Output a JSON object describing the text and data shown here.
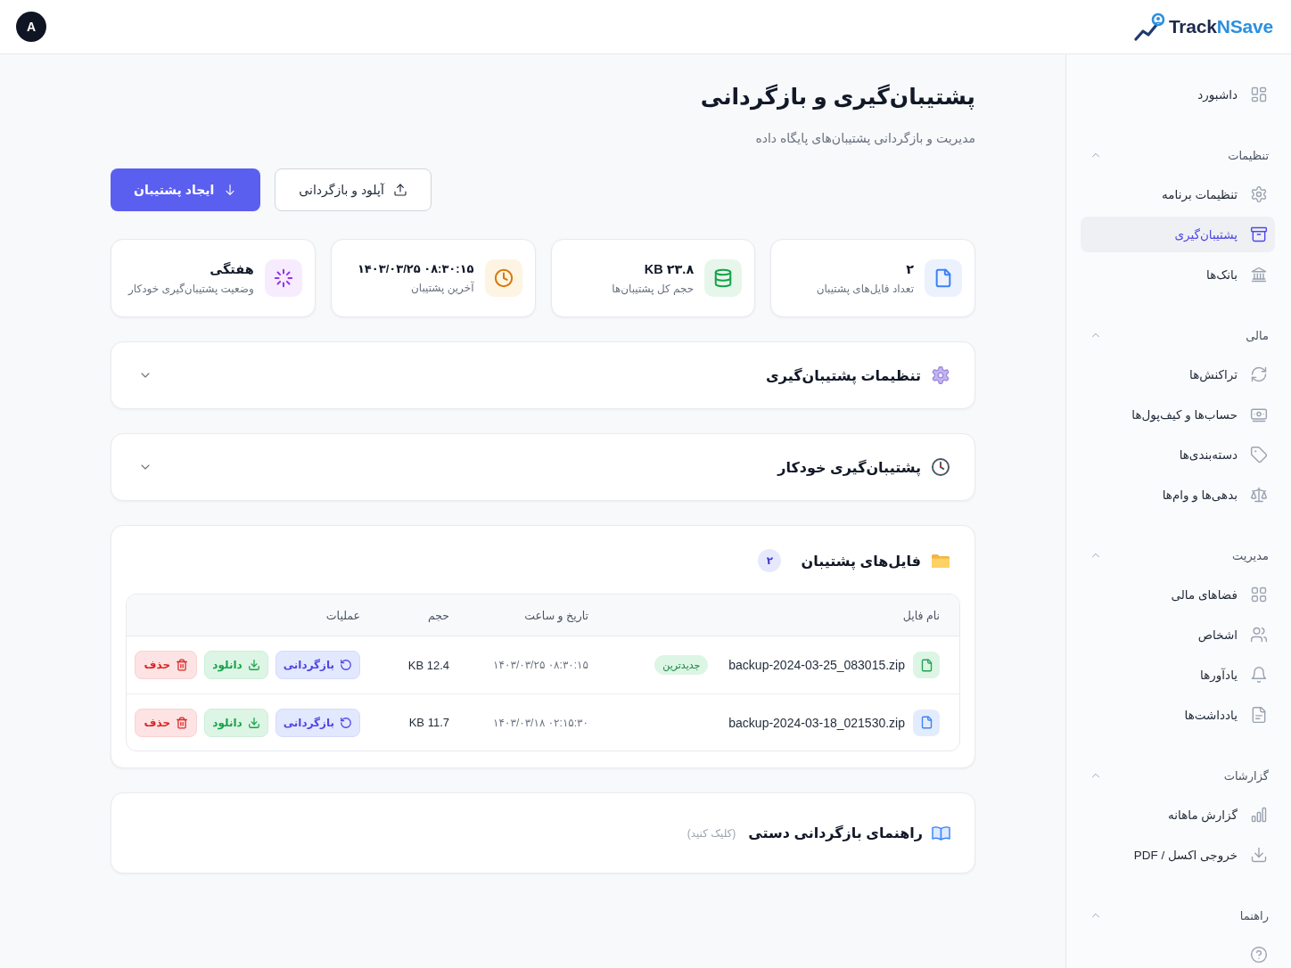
{
  "header": {
    "logo": {
      "text": "Track",
      "accent": "NSave"
    },
    "avatar": {
      "initial": "A"
    }
  },
  "sidebar": {
    "top_items": [
      {
        "label": "داشبورد",
        "selected": false
      }
    ],
    "sections": [
      {
        "title": "تنظیمات",
        "expanded": true,
        "items": [
          {
            "label": "تنظیمات برنامه",
            "selected": false
          },
          {
            "label": "پشتیبان‌گیری",
            "selected": true
          },
          {
            "label": "بانک‌ها",
            "selected": false
          }
        ]
      },
      {
        "title": "مالی",
        "expanded": true,
        "items": [
          {
            "label": "تراکنش‌ها",
            "selected": false
          },
          {
            "label": "حساب‌ها و کیف‌پول‌ها",
            "selected": false
          },
          {
            "label": "دسته‌بندی‌ها",
            "selected": false
          },
          {
            "label": "بدهی‌ها و وام‌ها",
            "selected": false
          }
        ]
      },
      {
        "title": "مدیریت",
        "expanded": true,
        "items": [
          {
            "label": "فضاهای مالی",
            "selected": false
          },
          {
            "label": "اشخاص",
            "selected": false
          },
          {
            "label": "یادآورها",
            "selected": false
          },
          {
            "label": "یادداشت‌ها",
            "selected": false
          }
        ]
      },
      {
        "title": "گزارشات",
        "expanded": true,
        "items": [
          {
            "label": "گزارش ماهانه",
            "selected": false
          },
          {
            "label": "خروجی اکسل / PDF",
            "selected": false
          }
        ]
      },
      {
        "title": "راهنما",
        "expanded": true,
        "items": [
          {
            "selected": false
          }
        ]
      }
    ]
  },
  "page": {
    "title": "پشتیبان‌گیری و بازگردانی",
    "subtitle": "مدیریت و بازگردانی پشتیبان‌های پایگاه داده",
    "actions": [
      {
        "kind": "upload",
        "label": "آپلود و بازگردانی"
      },
      {
        "kind": "create",
        "label": "ایجاد پشتیبان"
      }
    ]
  },
  "stats": [
    {
      "kind": "count",
      "value": "۲",
      "label": "تعداد فایل‌های پشتیبان"
    },
    {
      "kind": "size",
      "value": "۲۳.۸ KB",
      "label": "حجم کل پشتیبان‌ها"
    },
    {
      "kind": "datetime",
      "value": "۱۴۰۳/۰۳/۲۵ ۰۸:۳۰:۱۵",
      "label": "آخرین پشتیبان"
    },
    {
      "kind": "status",
      "value": "هفتگی",
      "label": "وضعیت پشتیبان‌گیری خودکار"
    }
  ],
  "panels": [
    {
      "title": "تنظیمات پشتیبان‌گیری",
      "expanded": false
    },
    {
      "title": "پشتیبان‌گیری خودکار",
      "expanded": false
    }
  ],
  "files": {
    "title": "فایل‌های پشتیبان",
    "count": "۲",
    "table": {
      "columns": [
        "نام فایل",
        "تاریخ و ساعت",
        "حجم",
        "عملیات"
      ],
      "rows": [
        {
          "file_name": "backup-2024-03-25_083015.zip",
          "latest": true,
          "badge": "جدیدترین",
          "date": "۱۴۰۳/۰۳/۲۵ ۰۸:۳۰:۱۵",
          "size": "12.4 KB",
          "actions": [
            {
              "kind": "restore",
              "label": "بازگردانی"
            },
            {
              "kind": "download",
              "label": "دانلود"
            },
            {
              "kind": "delete",
              "label": "حذف"
            }
          ]
        },
        {
          "file_name": "backup-2024-03-18_021530.zip",
          "latest": false,
          "date": "۱۴۰۳/۰۳/۱۸ ۰۲:۱۵:۳۰",
          "size": "11.7 KB",
          "actions": [
            {
              "kind": "restore",
              "label": "بازگردانی"
            },
            {
              "kind": "download",
              "label": "دانلود"
            },
            {
              "kind": "delete",
              "label": "حذف"
            }
          ]
        }
      ]
    }
  },
  "guide": {
    "title": "راهنمای بازگردانی دستی",
    "hint": "(کلیک کنید)"
  }
}
